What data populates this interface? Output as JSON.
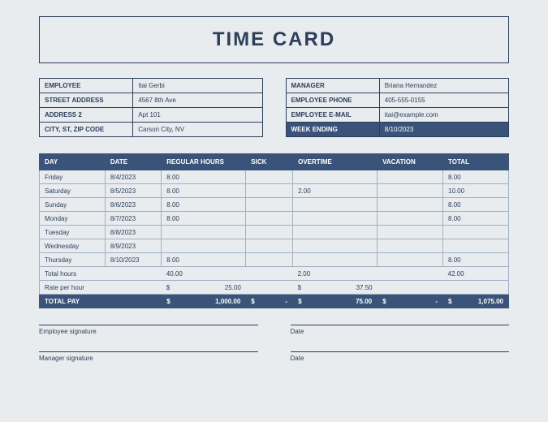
{
  "title": "TIME CARD",
  "employee_info": {
    "rows": [
      {
        "label": "EMPLOYEE",
        "value": "Itai Gerbi"
      },
      {
        "label": "STREET ADDRESS",
        "value": "4567 8th Ave"
      },
      {
        "label": "ADDRESS 2",
        "value": "Apt 101"
      },
      {
        "label": "CITY, ST,  ZIP CODE",
        "value": "Carson City, NV"
      }
    ]
  },
  "manager_info": {
    "rows": [
      {
        "label": "MANAGER",
        "value": "Briana Hernandez"
      },
      {
        "label": "EMPLOYEE PHONE",
        "value": "405-555-0155"
      },
      {
        "label": "EMPLOYEE E-MAIL",
        "value": "itai@example.com"
      },
      {
        "label": "WEEK ENDING",
        "value": "8/10/2023",
        "highlight": true
      }
    ]
  },
  "chart_data": {
    "type": "table",
    "headers": [
      "DAY",
      "DATE",
      "REGULAR HOURS",
      "SICK",
      "OVERTIME",
      "VACATION",
      "TOTAL"
    ],
    "rows": [
      {
        "day": "Friday",
        "date": "8/4/2023",
        "regular": "8.00",
        "sick": "",
        "overtime": "",
        "vacation": "",
        "total": "8.00"
      },
      {
        "day": "Saturday",
        "date": "8/5/2023",
        "regular": "8.00",
        "sick": "",
        "overtime": "2.00",
        "vacation": "",
        "total": "10.00"
      },
      {
        "day": "Sunday",
        "date": "8/6/2023",
        "regular": "8.00",
        "sick": "",
        "overtime": "",
        "vacation": "",
        "total": "8.00"
      },
      {
        "day": "Monday",
        "date": "8/7/2023",
        "regular": "8.00",
        "sick": "",
        "overtime": "",
        "vacation": "",
        "total": "8.00"
      },
      {
        "day": "Tuesday",
        "date": "8/8/2023",
        "regular": "",
        "sick": "",
        "overtime": "",
        "vacation": "",
        "total": ""
      },
      {
        "day": "Wednesday",
        "date": "8/9/2023",
        "regular": "",
        "sick": "",
        "overtime": "",
        "vacation": "",
        "total": ""
      },
      {
        "day": "Thursday",
        "date": "8/10/2023",
        "regular": "8.00",
        "sick": "",
        "overtime": "",
        "vacation": "",
        "total": "8.00"
      }
    ],
    "totals_hours": {
      "label": "Total hours",
      "regular": "40.00",
      "sick": "",
      "overtime": "2.00",
      "vacation": "",
      "total": "42.00"
    },
    "rate": {
      "label": "Rate per hour",
      "regular": "25.00",
      "sick": "",
      "overtime": "37.50",
      "vacation": ""
    },
    "total_pay": {
      "label": "TOTAL PAY",
      "regular": "1,000.00",
      "sick": "-",
      "overtime": "75.00",
      "vacation": "-",
      "total": "1,075.00"
    },
    "currency": "$"
  },
  "signatures": {
    "emp": "Employee signature",
    "mgr": "Manager signature",
    "date": "Date"
  }
}
